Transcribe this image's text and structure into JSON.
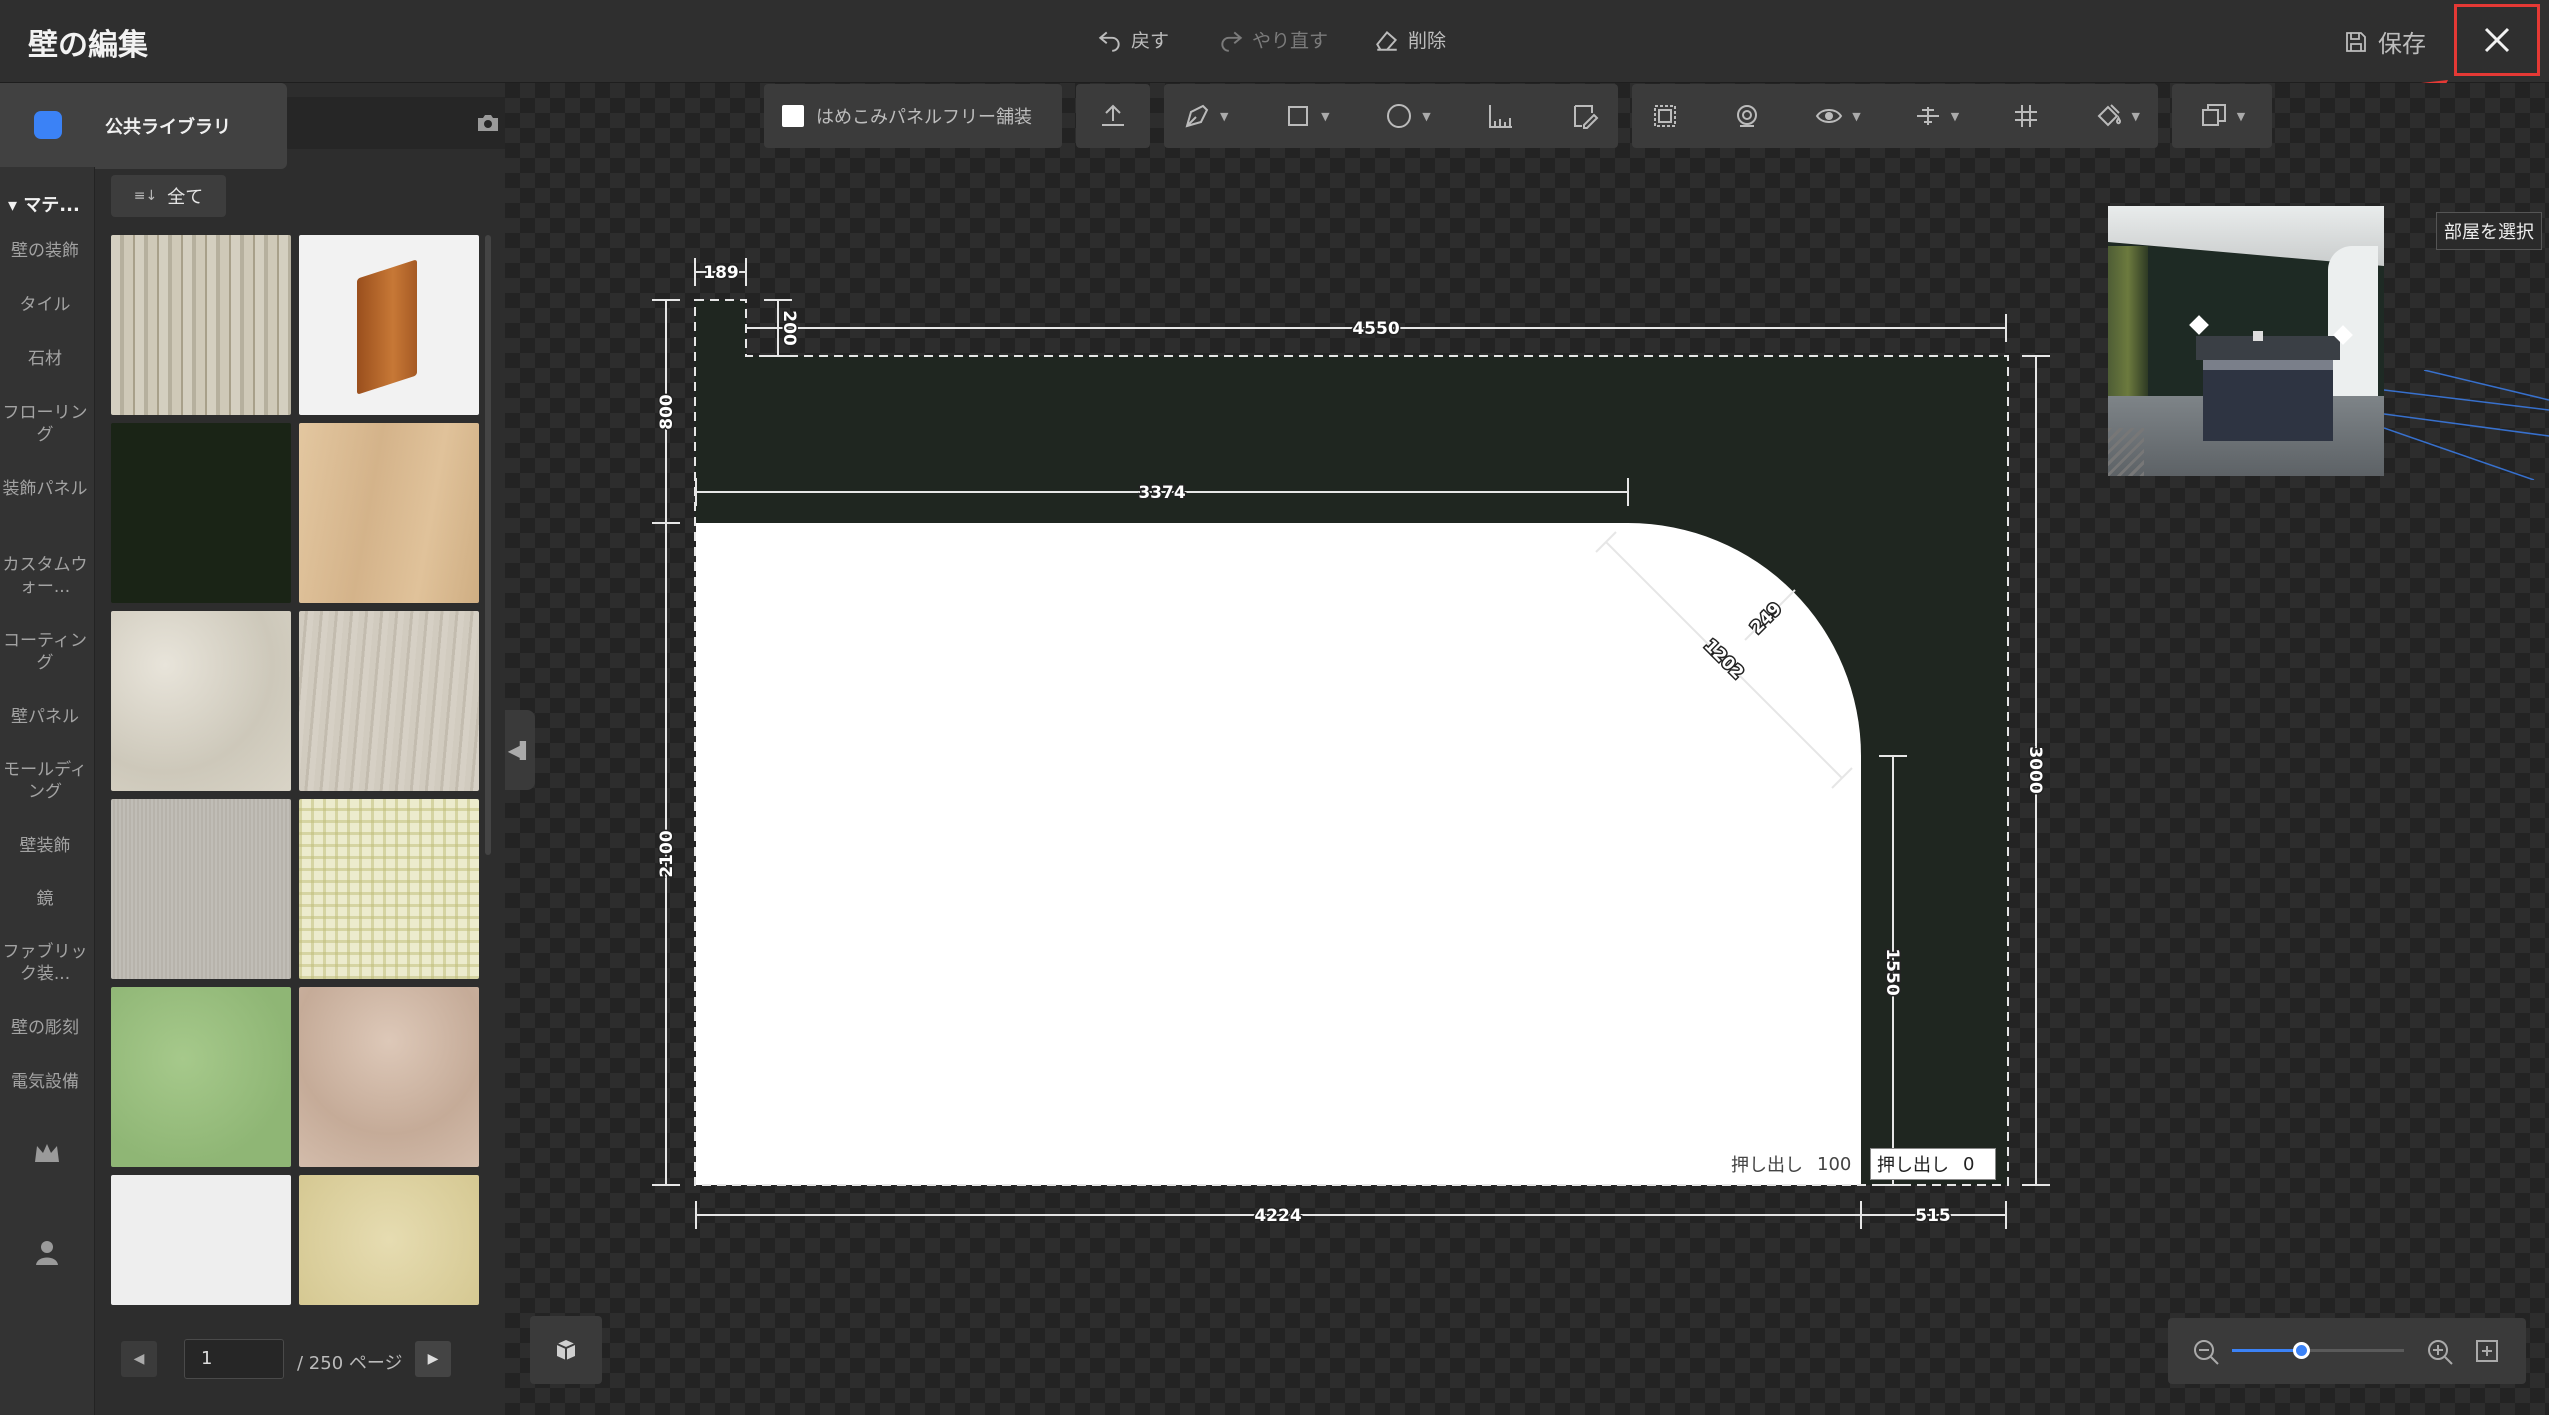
{
  "header": {
    "title": "壁の編集",
    "undo_label": "戻す",
    "redo_label": "やり直す",
    "delete_label": "削除",
    "save_label": "保存"
  },
  "rail": {
    "section_label": "マテ...",
    "items": [
      "壁の装飾",
      "タイル",
      "石材",
      "フローリング",
      "装飾パネル",
      "カスタムウォー...",
      "コーティング",
      "壁パネル",
      "モールディング",
      "壁装飾",
      "鏡",
      "ファブリック装...",
      "壁の彫刻",
      "電気設備"
    ]
  },
  "library": {
    "tab_label": "公共ライブラリ",
    "filter_label": "全て",
    "swatches": [
      {
        "name": "birch-wood-tile",
        "color": "#c9c4b4"
      },
      {
        "name": "wood-baseboard",
        "color": "#f0f0f0"
      },
      {
        "name": "dark-green-paint",
        "color": "#1a2416"
      },
      {
        "name": "light-oak",
        "color": "#d9bc95"
      },
      {
        "name": "white-marble-tile",
        "color": "#d8d3c6"
      },
      {
        "name": "grey-wood",
        "color": "#cbc5b8"
      },
      {
        "name": "grey-fabric",
        "color": "#bcb9b2"
      },
      {
        "name": "yellow-check",
        "color": "#e8e6c6"
      },
      {
        "name": "green-plaster",
        "color": "#98be7e"
      },
      {
        "name": "beige-marble",
        "color": "#cdb6a5"
      },
      {
        "name": "white-floral",
        "color": "#ecebea"
      },
      {
        "name": "gold-damask",
        "color": "#ddd2a4"
      }
    ],
    "pager": {
      "current": "1",
      "total": "/ 250 ページ"
    }
  },
  "toolbar": {
    "inset_panel_label": "はめこみパネルフリー舗装"
  },
  "drawing": {
    "wall_color": "#1f2620",
    "dimensions": {
      "top_offset": "189",
      "top_gap": "200",
      "top_total": "4550",
      "left_upper": "800",
      "inner_width": "3374",
      "radius": "1202",
      "small_radius": "249",
      "left_lower": "2100",
      "right_total": "3000",
      "right_inner": "1550",
      "bottom_opening": "4224",
      "bottom_right": "515"
    },
    "extrude_left": {
      "label": "押し出し",
      "value": "100"
    },
    "extrude_right": {
      "label": "押し出し",
      "value": "0"
    }
  },
  "preview": {
    "select_room_label": "部屋を選択"
  },
  "zoom": {
    "level": 0.4
  }
}
